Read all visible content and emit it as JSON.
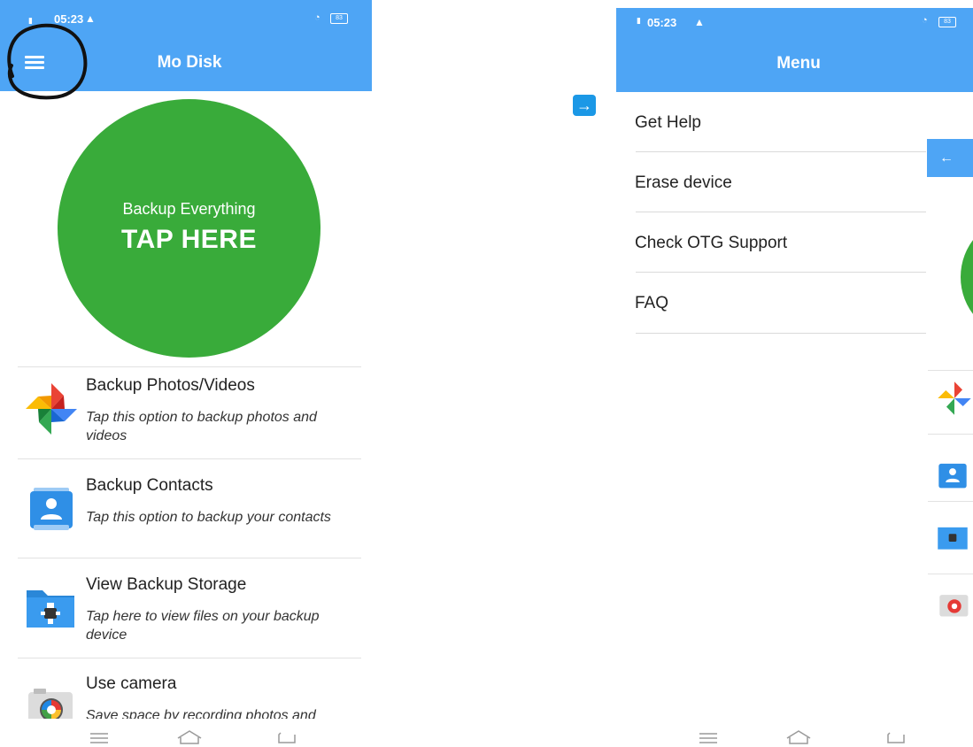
{
  "left": {
    "status": {
      "time": "05:23",
      "battery": "83"
    },
    "app_title": "Mo Disk",
    "backup_button": {
      "subtitle": "Backup Everything",
      "label": "TAP HERE"
    },
    "options": [
      {
        "title": "Backup Photos/Videos",
        "desc": "Tap this option to backup photos and videos",
        "icon": "pinwheel-icon"
      },
      {
        "title": "Backup Contacts",
        "desc": "Tap this option to backup your contacts",
        "icon": "contacts-icon"
      },
      {
        "title": "View Backup Storage",
        "desc": "Tap here to view files on your backup device",
        "icon": "usb-folder-icon"
      },
      {
        "title": "Use camera",
        "desc": "Save space by recording photos and",
        "icon": "camera-icon"
      }
    ]
  },
  "arrow": "→",
  "right": {
    "status": {
      "time": "05:23",
      "battery": "83"
    },
    "menu_title": "Menu",
    "menu_items": [
      "Get Help",
      "Erase device",
      "Check OTG Support",
      "FAQ"
    ],
    "back_icon": "←"
  },
  "colors": {
    "appbar": "#4ea5f5",
    "green": "#39ab3a",
    "arrow_badge": "#1b98e6"
  }
}
